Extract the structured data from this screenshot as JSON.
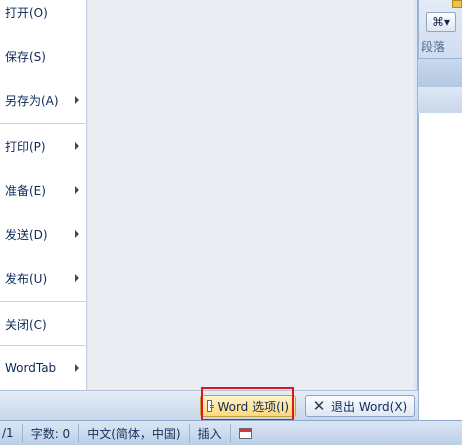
{
  "office_menu": {
    "items": [
      {
        "label": "打开(O)",
        "submenu": false
      },
      {
        "label": "保存(S)",
        "submenu": false
      },
      {
        "label": "另存为(A)",
        "submenu": true
      },
      {
        "label": "打印(P)",
        "submenu": true
      },
      {
        "label": "准备(E)",
        "submenu": true
      },
      {
        "label": "发送(D)",
        "submenu": true
      },
      {
        "label": "发布(U)",
        "submenu": true
      },
      {
        "label": "关闭(C)",
        "submenu": false
      },
      {
        "label": "WordTab",
        "submenu": true
      }
    ],
    "word_options_label": "Word 选项(I)",
    "exit_word_label": "退出 Word(X)"
  },
  "ribbon": {
    "group_label": "段落",
    "tool_glyph": "⌘▾"
  },
  "status_bar": {
    "page": "/1",
    "word_count": "字数: 0",
    "language": "中文(简体，中国)",
    "mode": "插入"
  },
  "colors": {
    "highlight": "#e0141e",
    "accent": "#ffd879"
  }
}
